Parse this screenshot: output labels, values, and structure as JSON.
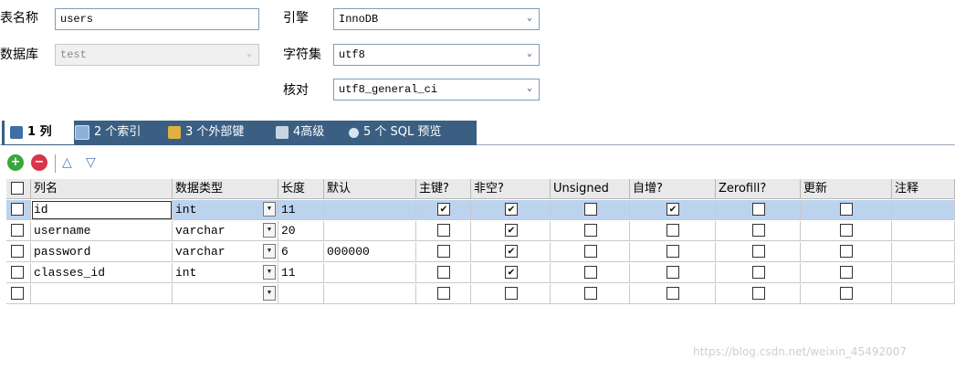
{
  "form": {
    "table_name_label": "表名称",
    "table_name_value": "users",
    "database_label": "数据库",
    "database_value": "test",
    "engine_label": "引擎",
    "engine_value": "InnoDB",
    "charset_label": "字符集",
    "charset_value": "utf8",
    "collation_label": "核对",
    "collation_value": "utf8_general_ci"
  },
  "tabs": [
    {
      "label": "1 列",
      "active": true
    },
    {
      "label": "2 个索引",
      "active": false
    },
    {
      "label": "3 个外部键",
      "active": false
    },
    {
      "label": "4高级",
      "active": false
    },
    {
      "label": "5 个 SQL 预览",
      "active": false
    }
  ],
  "columns": {
    "name": "列名",
    "type": "数据类型",
    "length": "长度",
    "default": "默认",
    "primary_key": "主键?",
    "not_null": "非空?",
    "unsigned": "Unsigned",
    "auto_increment": "自增?",
    "zerofill": "Zerofill?",
    "update": "更新",
    "comment": "注释"
  },
  "rows": [
    {
      "name": "id",
      "type": "int",
      "length": "11",
      "default": "",
      "pk": true,
      "nn": true,
      "unsigned": false,
      "ai": true,
      "zf": false,
      "upd": false,
      "comment": "",
      "selected": true
    },
    {
      "name": "username",
      "type": "varchar",
      "length": "20",
      "default": "",
      "pk": false,
      "nn": true,
      "unsigned": false,
      "ai": false,
      "zf": false,
      "upd": false,
      "comment": "",
      "selected": false
    },
    {
      "name": "password",
      "type": "varchar",
      "length": "6",
      "default": "000000",
      "pk": false,
      "nn": true,
      "unsigned": false,
      "ai": false,
      "zf": false,
      "upd": false,
      "comment": "",
      "selected": false
    },
    {
      "name": "classes_id",
      "type": "int",
      "length": "11",
      "default": "",
      "pk": false,
      "nn": true,
      "unsigned": false,
      "ai": false,
      "zf": false,
      "upd": false,
      "comment": "",
      "selected": false
    },
    {
      "name": "",
      "type": "",
      "length": "",
      "default": "",
      "pk": false,
      "nn": false,
      "unsigned": false,
      "ai": false,
      "zf": false,
      "upd": false,
      "comment": "",
      "selected": false
    }
  ],
  "watermark": "https://blog.csdn.net/weixin_45492007",
  "colors": {
    "tab_strip": "#3a5f82",
    "selected_row": "#bcd3ee",
    "header_bg": "#e9e9e9",
    "add_button": "#3aa53a",
    "remove_button": "#d9344a"
  },
  "icons": {
    "add": "add-circle-icon",
    "remove": "remove-circle-icon",
    "up": "move-up-icon",
    "down": "move-down-icon"
  }
}
